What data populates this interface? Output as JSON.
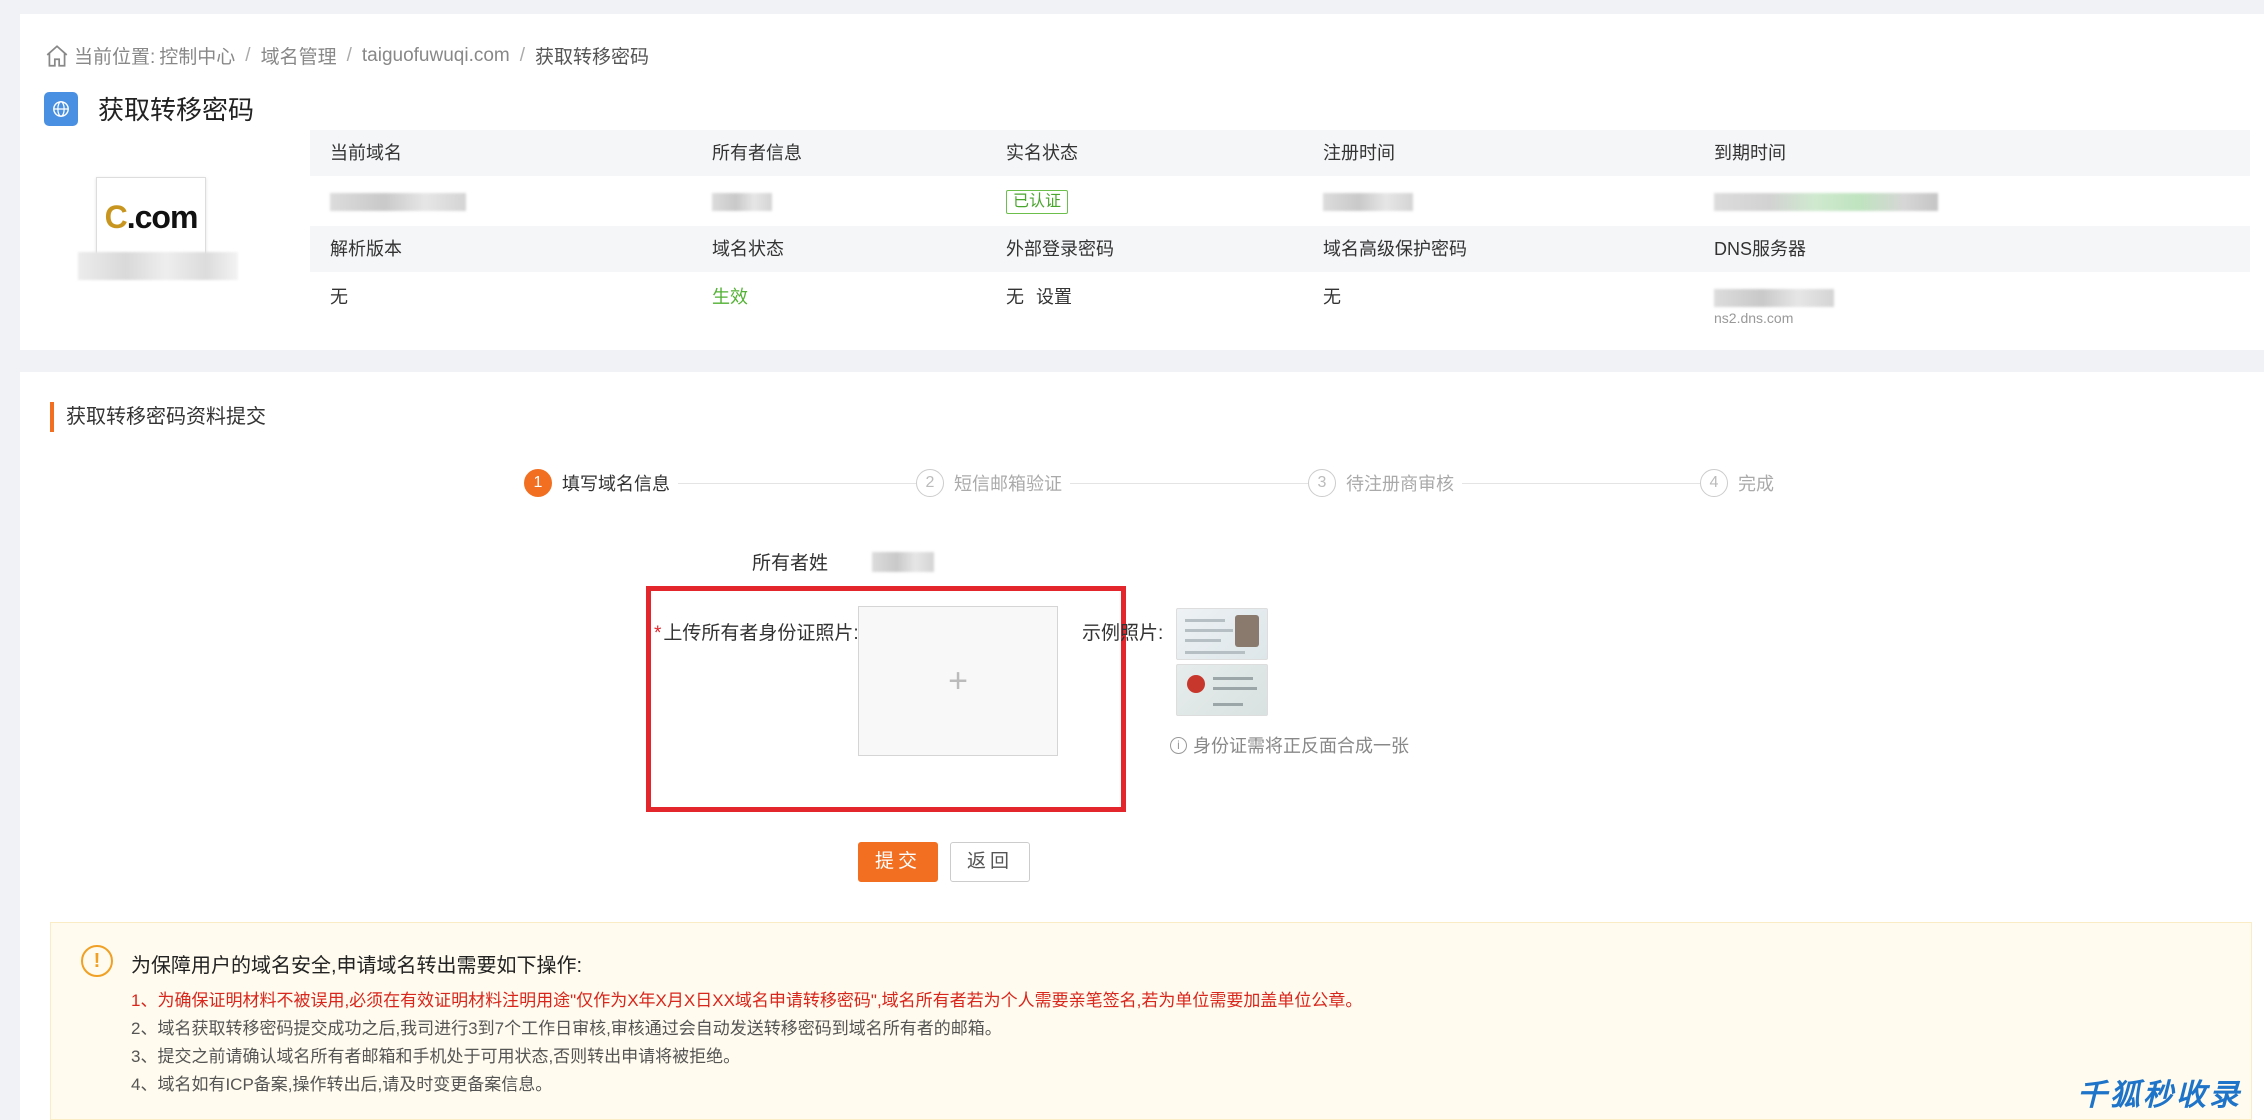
{
  "breadcrumb": {
    "prefix": "当前位置:",
    "items": [
      "控制中心",
      "域名管理",
      "taiguofuwuqi.com",
      "获取转移密码"
    ],
    "separator": "/"
  },
  "page": {
    "title": "获取转移密码",
    "title_icon": "globe-icon"
  },
  "logo": {
    "text_c": "C",
    "text_rest": ".com"
  },
  "info": {
    "headers_row1": [
      "当前域名",
      "所有者信息",
      "实名状态",
      "注册时间",
      "到期时间"
    ],
    "values_row1": {
      "verify_badge": "已认证"
    },
    "headers_row2": [
      "解析版本",
      "域名状态",
      "外部登录密码",
      "域名高级保护密码",
      "DNS服务器"
    ],
    "values_row2": {
      "dns_version": "无",
      "domain_status": "生效",
      "external_password": "无",
      "set_link": "设置",
      "advanced_password": "无",
      "dns_partial": "ns2.dns.com"
    }
  },
  "section": {
    "title": "获取转移密码资料提交"
  },
  "steps": [
    {
      "num": "1",
      "label": "填写域名信息",
      "active": true
    },
    {
      "num": "2",
      "label": "短信邮箱验证",
      "active": false
    },
    {
      "num": "3",
      "label": "待注册商审核",
      "active": false
    },
    {
      "num": "4",
      "label": "完成",
      "active": false
    }
  ],
  "form": {
    "owner_label": "所有者姓",
    "upload_required_mark": "*",
    "upload_label": "上传所有者身份证照片:",
    "upload_plus": "+",
    "example_label": "示例照片:",
    "hint_icon": "i",
    "hint_text": "身份证需将正反面合成一张"
  },
  "buttons": {
    "submit": "提交",
    "back": "返回"
  },
  "notice": {
    "icon": "!",
    "title": "为保障用户的域名安全,申请域名转出需要如下操作:",
    "items": [
      "1、为确保证明材料不被误用,必须在有效证明材料注明用途\"仅作为X年X月X日XX域名申请转移密码\",域名所有者若为个人需要亲笔签名,若为单位需要加盖单位公章。",
      "2、域名获取转移密码提交成功之后,我司进行3到7个工作日审核,审核通过会自动发送转移密码到域名所有者的邮箱。",
      "3、提交之前请确认域名所有者邮箱和手机处于可用状态,否则转出申请将被拒绝。",
      "4、域名如有ICP备案,操作转出后,请及时变更备案信息。"
    ]
  },
  "watermark": "千狐秒收录",
  "colors": {
    "accent": "#f26f21",
    "highlight_border": "#e2262c",
    "status_green": "#52b233"
  }
}
